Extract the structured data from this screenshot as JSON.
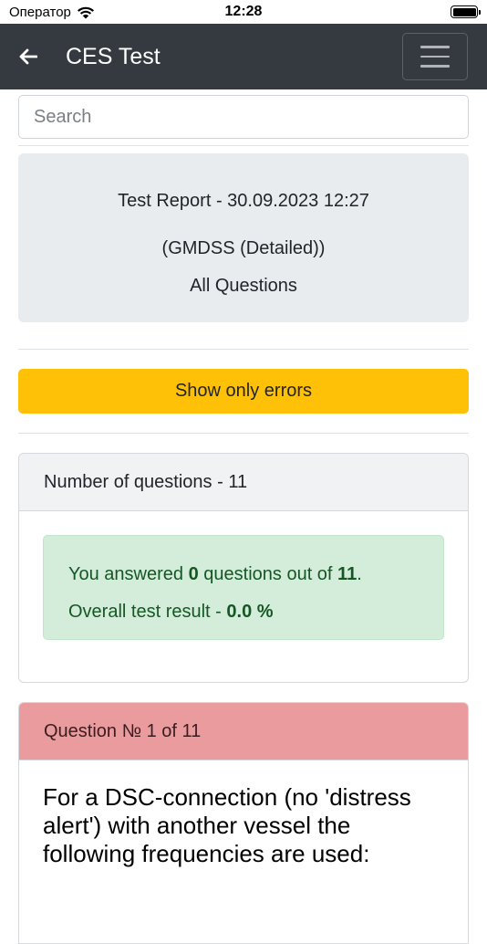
{
  "status_bar": {
    "carrier": "Оператор",
    "time": "12:28"
  },
  "navbar": {
    "title": "CES Test"
  },
  "search": {
    "placeholder": "Search"
  },
  "report": {
    "title": "Test Report - 30.09.2023 12:27",
    "subtitle": "(GMDSS (Detailed))",
    "scope": "All Questions"
  },
  "filter": {
    "show_errors_label": "Show only errors"
  },
  "summary": {
    "header": "Number of questions - 11",
    "answered_prefix": "You answered ",
    "answered_count": "0",
    "answered_middle": " questions out of ",
    "total": "11",
    "answered_suffix": ".",
    "result_prefix": "Overall test result - ",
    "result_value": "0.0 %"
  },
  "question": {
    "header": "Question № 1 of 11",
    "text": "For a DSC-connection (no 'distress alert') with another vessel the following frequencies are used:"
  },
  "colors": {
    "navbar": "#343a40",
    "warning": "#ffc107",
    "success_bg": "#d4edda",
    "danger_header": "#ea9b9d"
  }
}
